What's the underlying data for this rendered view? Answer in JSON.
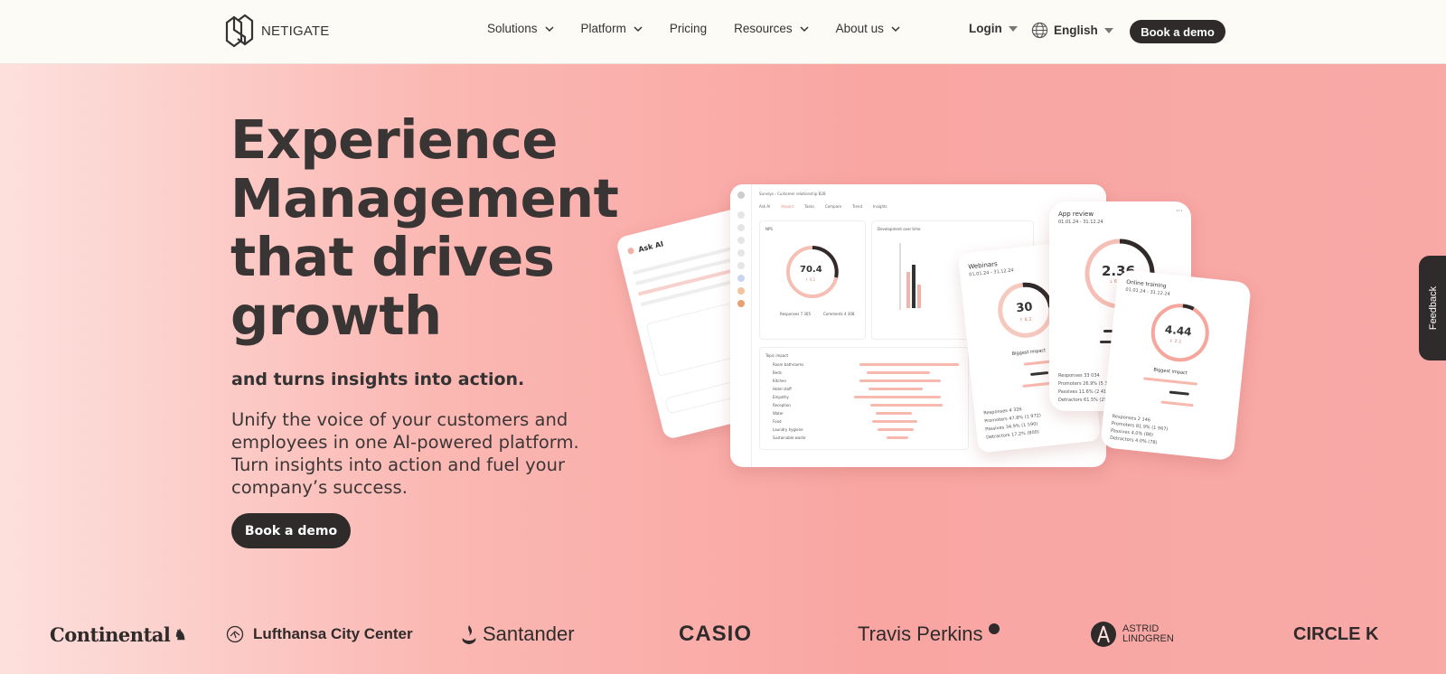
{
  "brand": {
    "name": "NETIGATE",
    "logo_icon": "netigate-logo"
  },
  "nav": {
    "items": [
      {
        "label": "Solutions",
        "has_dropdown": true
      },
      {
        "label": "Platform",
        "has_dropdown": true
      },
      {
        "label": "Pricing",
        "has_dropdown": false
      },
      {
        "label": "Resources",
        "has_dropdown": true
      },
      {
        "label": "About us",
        "has_dropdown": true
      }
    ],
    "login": "Login",
    "language": "English",
    "cta": "Book a demo"
  },
  "hero": {
    "title": "Experience Management that drives growth",
    "subtitle": "and turns insights into action.",
    "description": "Unify the voice of your customers and employees in one AI-powered platform. Turn insights into action and fuel your company’s success.",
    "cta": "Book a demo"
  },
  "mockup": {
    "ask_ai_title": "Ask AI",
    "dashboard": {
      "breadcrumb": "Surveys  ›  Customer relationship B2B",
      "tabs": [
        "Ask AI",
        "Impact",
        "Tasks",
        "Compare",
        "Trend",
        "Insights"
      ],
      "nps_label": "NPS",
      "nps_score": "70.4",
      "nps_delta": "↑ 4.2",
      "responses": "Responses 7 305",
      "comments": "Comments 4 308",
      "dev_label": "Development over time",
      "topics_label": "Topic impact",
      "topics": [
        "Room bathrooms",
        "Beds",
        "Kitchen",
        "Hotel staff",
        "Empathy",
        "Reception",
        "Water",
        "Food",
        "Laundry hygiene",
        "Sustainable waste"
      ]
    },
    "webinars": {
      "title": "Webinars",
      "date": "01.01.24 - 31.12.24",
      "score": "30",
      "delta": "↑ 8.2",
      "impact_title": "Biggest impact",
      "stats": [
        "Responses  4 326",
        "Promoters  47.8% (1 972)",
        "Passives  34.9% (1 590)",
        "Detractors  17.2% (800)"
      ]
    },
    "app_review": {
      "title": "App review",
      "date": "01.01.24 - 31.12.24",
      "score": "2.36",
      "delta": "↓ 6.1",
      "stats": [
        "Responses  33 034",
        "Promoters  26.9% (5 301)",
        "Passives  11.6% (2 418)",
        "Detractors  61.5% (25 321)"
      ]
    },
    "online_training": {
      "title": "Online training",
      "date": "01.01.24 - 31.12.24",
      "score": "4.44",
      "delta": "↓ 2.1",
      "impact_title": "Biggest impact",
      "stats": [
        "Responses  2 146",
        "Promoters  81.9% (1 967)",
        "Passives  4.0% (88)",
        "Detractors  4.0% (78)"
      ]
    }
  },
  "feedback_tab": "Feedback",
  "logos": [
    "Continental",
    "Lufthansa City Center",
    "Santander",
    "CASIO",
    "Travis Perkins",
    "ASTRID LINDGREN",
    "CIRCLE K"
  ],
  "colors": {
    "dark": "#2f2b2b",
    "accent": "#f7a7a1",
    "header_bg": "#fdfbf6"
  }
}
